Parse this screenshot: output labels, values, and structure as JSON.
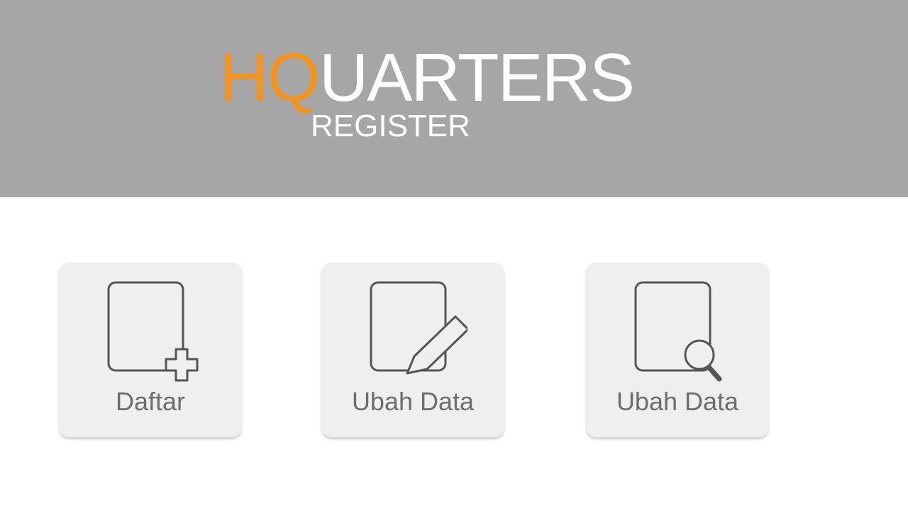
{
  "header": {
    "logo_hq": "HQ",
    "logo_rest": "UARTERS",
    "logo_sub": "REGISTER",
    "colors": {
      "background": "#a6a6a6",
      "accent": "#f39420",
      "logo_text": "#ffffff"
    }
  },
  "tiles": [
    {
      "label": "Daftar",
      "icon": "document-add-icon"
    },
    {
      "label": "Ubah Data",
      "icon": "document-edit-icon"
    },
    {
      "label": "Ubah Data",
      "icon": "document-search-icon"
    }
  ]
}
